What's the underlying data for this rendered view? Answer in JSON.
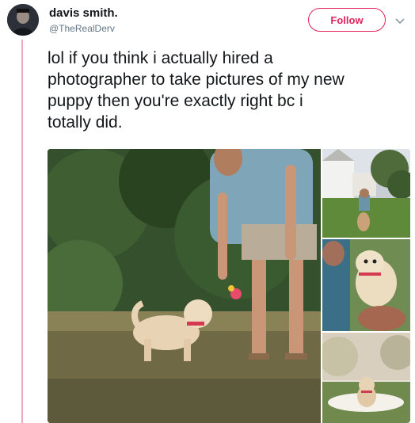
{
  "user": {
    "display_name": "davis smith.",
    "handle": "@TheRealDerv"
  },
  "follow_label": "Follow",
  "tweet_text": "lol if you think i actually hired a\nphotographer to take pictures of my new\npuppy then you're exactly right bc i\ntotally did.",
  "icons": {
    "avatar": "user-avatar",
    "more": "chevron-down-icon"
  },
  "colors": {
    "accent": "#e0245e",
    "thread_line": "#f3a6c4",
    "text": "#14171a",
    "secondary": "#657786"
  }
}
